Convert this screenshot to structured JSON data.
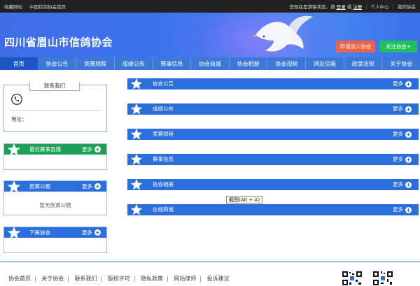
{
  "topbar": {
    "left": [
      "收藏网址",
      "中国信鸽协会首页"
    ],
    "status_text": "您现在是游客状态，请",
    "login": "登录",
    "or": "或",
    "register": "注册",
    "user_center": "个人中心",
    "my_assoc": "我的协会"
  },
  "banner": {
    "title": "四川省眉山市信鸽协会",
    "join_btn": "申请加入协会",
    "follow_btn": "关注协会+"
  },
  "nav": {
    "items": [
      "首页",
      "协会公告",
      "竞赛规程",
      "成绩公布",
      "赛事信息",
      "协会商城",
      "协会相册",
      "协会视频",
      "鸽友信箱",
      "政策法规",
      "关于协会"
    ],
    "active_index": 0
  },
  "contact": {
    "title": "联系我们",
    "address_label": "地址："
  },
  "sidebar": {
    "live": {
      "title": "最近赛事直播",
      "more": "更多",
      "color": "#1c9f57"
    },
    "results": {
      "title": "旌赛公棚",
      "more": "更多",
      "empty": "暂无旌赛公棚"
    },
    "sub": {
      "title": "下属协会",
      "more": "更多"
    }
  },
  "sections": [
    {
      "title": "协会公告",
      "more": "更多"
    },
    {
      "title": "成绩公布",
      "more": "更多"
    },
    {
      "title": "竞赛规程",
      "more": "更多"
    },
    {
      "title": "赛事信息",
      "more": "更多"
    },
    {
      "title": "协会相册",
      "more": "更多"
    },
    {
      "title": "在线商城",
      "more": "更多"
    }
  ],
  "tooltip": "截图(Alt + A)",
  "footer": {
    "links": [
      "协会首页",
      "关于协会",
      "联系我们",
      "版权许可",
      "隐私政策",
      "网站律师",
      "投诉建议"
    ]
  },
  "colors": {
    "nav": "#3c78d8",
    "nav_active": "#1d56c4",
    "bar": "#2a6fdb",
    "green": "#1c9f57"
  }
}
